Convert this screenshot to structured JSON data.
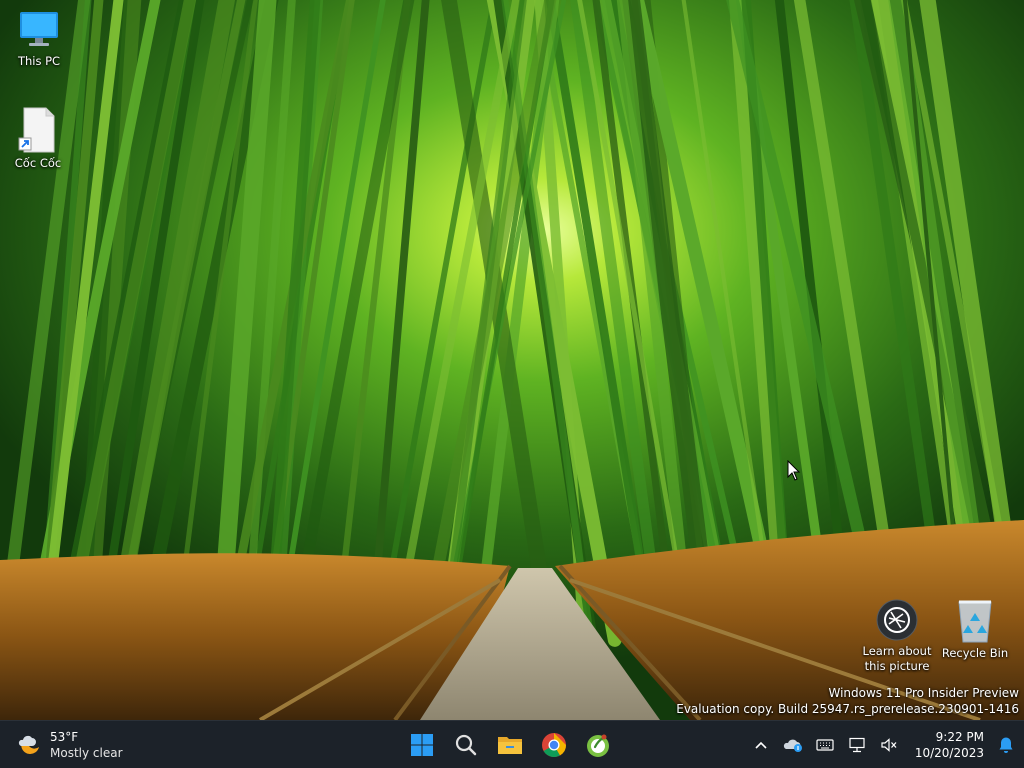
{
  "desktop": {
    "icons": [
      {
        "label": "This PC",
        "icon": "computer-icon"
      },
      {
        "label": "Cốc Cốc",
        "icon": "document-shortcut-icon"
      },
      {
        "label": "Learn about this picture",
        "icon": "camera-aperture-icon"
      },
      {
        "label": "Recycle Bin",
        "icon": "recycle-bin-icon"
      }
    ],
    "watermark": {
      "line1": "Windows 11 Pro Insider Preview",
      "line2": "Evaluation copy. Build 25947.rs_prerelease.230901-1416"
    }
  },
  "taskbar": {
    "weather": {
      "temperature": "53°F",
      "condition": "Mostly clear",
      "icon": "moon-cloud-icon"
    },
    "apps": [
      {
        "name": "Start",
        "icon": "windows-logo-icon",
        "color": "#2b9df4"
      },
      {
        "name": "Search",
        "icon": "search-icon",
        "color": "#e0e0e0"
      },
      {
        "name": "File Explorer",
        "icon": "folder-icon",
        "color": "#f6c33d"
      },
      {
        "name": "Google Chrome",
        "icon": "chrome-icon",
        "color": "#4285f4"
      },
      {
        "name": "Cốc Cốc",
        "icon": "coccoc-icon",
        "color": "#7ac142"
      }
    ],
    "tray": {
      "icons": [
        "chevron-up-icon",
        "onedrive-icon",
        "keyboard-icon",
        "network-icon",
        "volume-muted-icon"
      ],
      "time": "9:22 PM",
      "date": "10/20/2023",
      "notification_icon": "bell-icon"
    }
  },
  "colors": {
    "taskbar_bg": "#1c2229",
    "accent": "#2b9df4"
  }
}
